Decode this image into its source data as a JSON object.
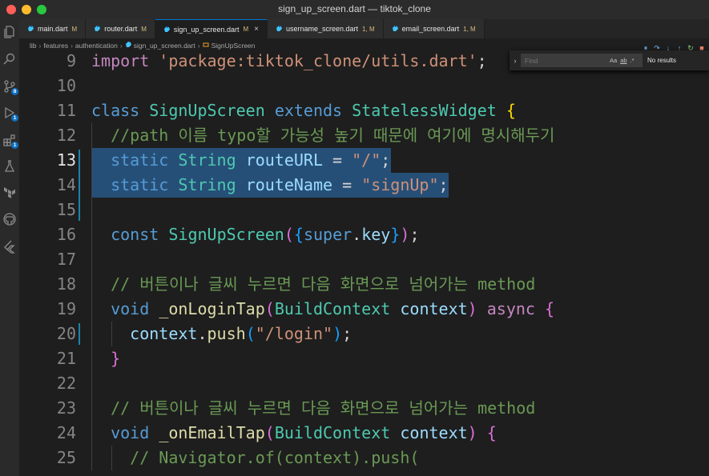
{
  "window": {
    "title": "sign_up_screen.dart — tiktok_clone"
  },
  "activity_bar": {
    "items": [
      {
        "icon": "files-icon",
        "badge": ""
      },
      {
        "icon": "search-icon",
        "badge": ""
      },
      {
        "icon": "source-control-icon",
        "badge": "8"
      },
      {
        "icon": "run-debug-icon",
        "badge": "1"
      },
      {
        "icon": "extensions-icon",
        "badge": "1"
      },
      {
        "icon": "testing-icon",
        "badge": ""
      },
      {
        "icon": "terraform-icon",
        "badge": ""
      },
      {
        "icon": "github-icon",
        "badge": ""
      },
      {
        "icon": "flutter-icon",
        "badge": ""
      }
    ]
  },
  "tabs": [
    {
      "name": "main.dart",
      "status": "M",
      "active": false
    },
    {
      "name": "router.dart",
      "status": "M",
      "active": false
    },
    {
      "name": "sign_up_screen.dart",
      "status": "M",
      "active": true,
      "close": "×"
    },
    {
      "name": "username_screen.dart",
      "status": "1, M",
      "active": false
    },
    {
      "name": "email_screen.dart",
      "status": "1, M",
      "active": false
    }
  ],
  "breadcrumb": [
    "lib",
    "features",
    "authentication",
    "sign_up_screen.dart",
    "SignUpScreen"
  ],
  "find_widget": {
    "toggle": "›",
    "placeholder": "Find",
    "value": "",
    "match_case": "Aa",
    "whole_word": "ab",
    "regex": ".*",
    "result": "No results"
  },
  "debug_toolbar": [
    "⏸",
    "↷",
    "↓",
    "↑",
    "↻",
    "■"
  ],
  "editor": {
    "current_line": 13,
    "lines": [
      {
        "num": "9",
        "tokens": [
          [
            "kw2",
            "import"
          ],
          [
            "pun",
            " "
          ],
          [
            "str",
            "'package:tiktok_clone/utils.dart'"
          ],
          [
            "pun",
            ";"
          ]
        ]
      },
      {
        "num": "10",
        "tokens": []
      },
      {
        "num": "11",
        "tokens": [
          [
            "kw",
            "class"
          ],
          [
            "pun",
            " "
          ],
          [
            "cls",
            "SignUpScreen"
          ],
          [
            "pun",
            " "
          ],
          [
            "kw",
            "extends"
          ],
          [
            "pun",
            " "
          ],
          [
            "cls",
            "StatelessWidget"
          ],
          [
            "pun",
            " "
          ],
          [
            "br1",
            "{"
          ]
        ]
      },
      {
        "num": "12",
        "tokens": [
          [
            "pun",
            "  "
          ],
          [
            "cm",
            "//path 이름 typo할 가능성 높기 때문에 여기에 명시해두기"
          ]
        ]
      },
      {
        "num": "13",
        "tokens": [
          [
            "pun",
            "  "
          ],
          [
            "kw",
            "static"
          ],
          [
            "pun",
            " "
          ],
          [
            "cls",
            "String"
          ],
          [
            "pun",
            " "
          ],
          [
            "var",
            "routeURL"
          ],
          [
            "pun",
            " = "
          ],
          [
            "str",
            "\"/\""
          ],
          [
            "pun",
            ";"
          ]
        ],
        "selected": true
      },
      {
        "num": "14",
        "tokens": [
          [
            "pun",
            "  "
          ],
          [
            "kw",
            "static"
          ],
          [
            "pun",
            " "
          ],
          [
            "cls",
            "String"
          ],
          [
            "pun",
            " "
          ],
          [
            "var",
            "routeName"
          ],
          [
            "pun",
            " = "
          ],
          [
            "str",
            "\"signUp\""
          ],
          [
            "pun",
            ";"
          ]
        ],
        "selected": true
      },
      {
        "num": "15",
        "tokens": []
      },
      {
        "num": "16",
        "tokens": [
          [
            "pun",
            "  "
          ],
          [
            "kw",
            "const"
          ],
          [
            "pun",
            " "
          ],
          [
            "cls",
            "SignUpScreen"
          ],
          [
            "br2",
            "("
          ],
          [
            "br3",
            "{"
          ],
          [
            "kw",
            "super"
          ],
          [
            "pun",
            "."
          ],
          [
            "var",
            "key"
          ],
          [
            "br3",
            "}"
          ],
          [
            "br2",
            ")"
          ],
          [
            "pun",
            ";"
          ]
        ]
      },
      {
        "num": "17",
        "tokens": []
      },
      {
        "num": "18",
        "tokens": [
          [
            "pun",
            "  "
          ],
          [
            "cm",
            "// 버튼이나 글씨 누르면 다음 화면으로 넘어가는 method"
          ]
        ]
      },
      {
        "num": "19",
        "tokens": [
          [
            "pun",
            "  "
          ],
          [
            "kw",
            "void"
          ],
          [
            "pun",
            " "
          ],
          [
            "fn",
            "_onLoginTap"
          ],
          [
            "br2",
            "("
          ],
          [
            "cls",
            "BuildContext"
          ],
          [
            "pun",
            " "
          ],
          [
            "var",
            "context"
          ],
          [
            "br2",
            ")"
          ],
          [
            "pun",
            " "
          ],
          [
            "kw2",
            "async"
          ],
          [
            "pun",
            " "
          ],
          [
            "br2",
            "{"
          ]
        ]
      },
      {
        "num": "20",
        "tokens": [
          [
            "pun",
            "    "
          ],
          [
            "var",
            "context"
          ],
          [
            "pun",
            "."
          ],
          [
            "fn",
            "push"
          ],
          [
            "br3",
            "("
          ],
          [
            "str",
            "\"/login\""
          ],
          [
            "br3",
            ")"
          ],
          [
            "pun",
            ";"
          ]
        ]
      },
      {
        "num": "21",
        "tokens": [
          [
            "pun",
            "  "
          ],
          [
            "br2",
            "}"
          ]
        ]
      },
      {
        "num": "22",
        "tokens": []
      },
      {
        "num": "23",
        "tokens": [
          [
            "pun",
            "  "
          ],
          [
            "cm",
            "// 버튼이나 글씨 누르면 다음 화면으로 넘어가는 method"
          ]
        ]
      },
      {
        "num": "24",
        "tokens": [
          [
            "pun",
            "  "
          ],
          [
            "kw",
            "void"
          ],
          [
            "pun",
            " "
          ],
          [
            "fn",
            "_onEmailTap"
          ],
          [
            "br2",
            "("
          ],
          [
            "cls",
            "BuildContext"
          ],
          [
            "pun",
            " "
          ],
          [
            "var",
            "context"
          ],
          [
            "br2",
            ")"
          ],
          [
            "pun",
            " "
          ],
          [
            "br2",
            "{"
          ]
        ]
      },
      {
        "num": "25",
        "tokens": [
          [
            "pun",
            "    "
          ],
          [
            "cm",
            "// Navigator.of(context).push("
          ]
        ]
      }
    ]
  },
  "colors": {
    "editor_bg": "#1e1e1e",
    "selection": "#264f78",
    "accent": "#0078d4",
    "modified": "#d7ba7d"
  }
}
